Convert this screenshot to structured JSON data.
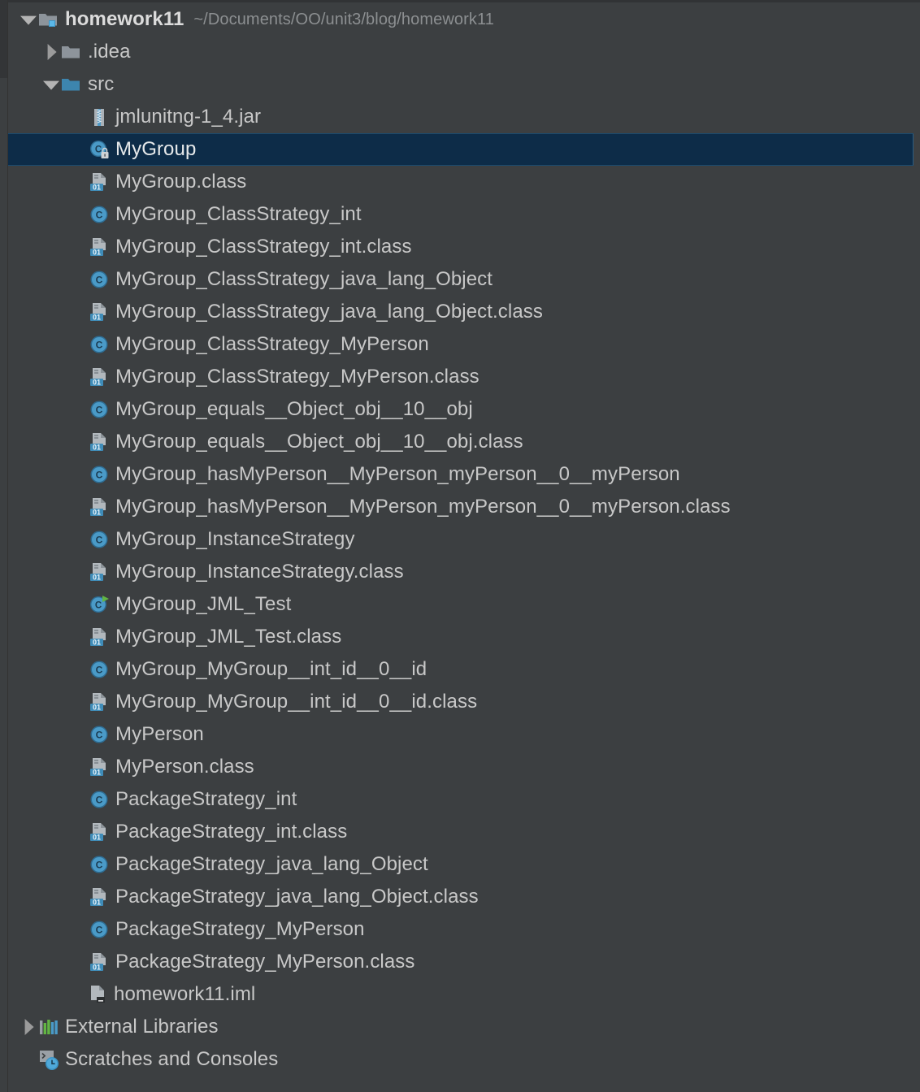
{
  "panel": {
    "name": "project-tool-window",
    "theme": {
      "background": "#3c3f41",
      "selection_background": "#0d2c48",
      "text": "#c8c8c8",
      "secondary_text": "#8c8f91",
      "accent_blue": "#3d95c6",
      "folder_blue": "#3d7fa8",
      "folder_gray": "#9aa0a6",
      "run_green": "#62b543"
    }
  },
  "tree": {
    "root": {
      "label": "homework11",
      "path_hint": "~/Documents/OO/unit3/blog/homework11",
      "icon": "module-folder-icon",
      "expanded": true,
      "twisty": "chevron-down-icon"
    },
    "nodes": [
      {
        "label": ".idea",
        "icon": "folder-icon",
        "indent": 1,
        "twisty": "chevron-right-icon",
        "expanded": false,
        "selected": false
      },
      {
        "label": "src",
        "icon": "source-folder-icon",
        "indent": 1,
        "twisty": "chevron-down-icon",
        "expanded": true,
        "selected": false
      },
      {
        "label": "jmlunitng-1_4.jar",
        "icon": "jar-icon",
        "indent": 2,
        "twisty": "none",
        "selected": false
      },
      {
        "label": "MyGroup",
        "icon": "java-class-locked-icon",
        "indent": 2,
        "twisty": "none",
        "selected": true
      },
      {
        "label": "MyGroup.class",
        "icon": "class-file-icon",
        "indent": 2,
        "twisty": "none",
        "selected": false
      },
      {
        "label": "MyGroup_ClassStrategy_int",
        "icon": "java-class-icon",
        "indent": 2,
        "twisty": "none",
        "selected": false
      },
      {
        "label": "MyGroup_ClassStrategy_int.class",
        "icon": "class-file-icon",
        "indent": 2,
        "twisty": "none",
        "selected": false
      },
      {
        "label": "MyGroup_ClassStrategy_java_lang_Object",
        "icon": "java-class-icon",
        "indent": 2,
        "twisty": "none",
        "selected": false
      },
      {
        "label": "MyGroup_ClassStrategy_java_lang_Object.class",
        "icon": "class-file-icon",
        "indent": 2,
        "twisty": "none",
        "selected": false
      },
      {
        "label": "MyGroup_ClassStrategy_MyPerson",
        "icon": "java-class-icon",
        "indent": 2,
        "twisty": "none",
        "selected": false
      },
      {
        "label": "MyGroup_ClassStrategy_MyPerson.class",
        "icon": "class-file-icon",
        "indent": 2,
        "twisty": "none",
        "selected": false
      },
      {
        "label": "MyGroup_equals__Object_obj__10__obj",
        "icon": "java-class-icon",
        "indent": 2,
        "twisty": "none",
        "selected": false
      },
      {
        "label": "MyGroup_equals__Object_obj__10__obj.class",
        "icon": "class-file-icon",
        "indent": 2,
        "twisty": "none",
        "selected": false
      },
      {
        "label": "MyGroup_hasMyPerson__MyPerson_myPerson__0__myPerson",
        "icon": "java-class-icon",
        "indent": 2,
        "twisty": "none",
        "selected": false
      },
      {
        "label": "MyGroup_hasMyPerson__MyPerson_myPerson__0__myPerson.class",
        "icon": "class-file-icon",
        "indent": 2,
        "twisty": "none",
        "selected": false
      },
      {
        "label": "MyGroup_InstanceStrategy",
        "icon": "java-class-icon",
        "indent": 2,
        "twisty": "none",
        "selected": false
      },
      {
        "label": "MyGroup_InstanceStrategy.class",
        "icon": "class-file-icon",
        "indent": 2,
        "twisty": "none",
        "selected": false
      },
      {
        "label": "MyGroup_JML_Test",
        "icon": "java-class-runnable-icon",
        "indent": 2,
        "twisty": "none",
        "selected": false
      },
      {
        "label": "MyGroup_JML_Test.class",
        "icon": "class-file-icon",
        "indent": 2,
        "twisty": "none",
        "selected": false
      },
      {
        "label": "MyGroup_MyGroup__int_id__0__id",
        "icon": "java-class-icon",
        "indent": 2,
        "twisty": "none",
        "selected": false
      },
      {
        "label": "MyGroup_MyGroup__int_id__0__id.class",
        "icon": "class-file-icon",
        "indent": 2,
        "twisty": "none",
        "selected": false
      },
      {
        "label": "MyPerson",
        "icon": "java-class-icon",
        "indent": 2,
        "twisty": "none",
        "selected": false
      },
      {
        "label": "MyPerson.class",
        "icon": "class-file-icon",
        "indent": 2,
        "twisty": "none",
        "selected": false
      },
      {
        "label": "PackageStrategy_int",
        "icon": "java-class-icon",
        "indent": 2,
        "twisty": "none",
        "selected": false
      },
      {
        "label": "PackageStrategy_int.class",
        "icon": "class-file-icon",
        "indent": 2,
        "twisty": "none",
        "selected": false
      },
      {
        "label": "PackageStrategy_java_lang_Object",
        "icon": "java-class-icon",
        "indent": 2,
        "twisty": "none",
        "selected": false
      },
      {
        "label": "PackageStrategy_java_lang_Object.class",
        "icon": "class-file-icon",
        "indent": 2,
        "twisty": "none",
        "selected": false
      },
      {
        "label": "PackageStrategy_MyPerson",
        "icon": "java-class-icon",
        "indent": 2,
        "twisty": "none",
        "selected": false
      },
      {
        "label": "PackageStrategy_MyPerson.class",
        "icon": "class-file-icon",
        "indent": 2,
        "twisty": "none",
        "selected": false
      },
      {
        "label": "homework11.iml",
        "icon": "iml-file-icon",
        "indent": 1,
        "twisty": "none",
        "selected": false
      },
      {
        "label": "External Libraries",
        "icon": "libraries-icon",
        "indent": 0,
        "twisty": "chevron-right-icon",
        "expanded": false,
        "selected": false
      },
      {
        "label": "Scratches and Consoles",
        "icon": "scratches-icon",
        "indent": 0,
        "twisty": "none",
        "selected": false
      }
    ]
  }
}
